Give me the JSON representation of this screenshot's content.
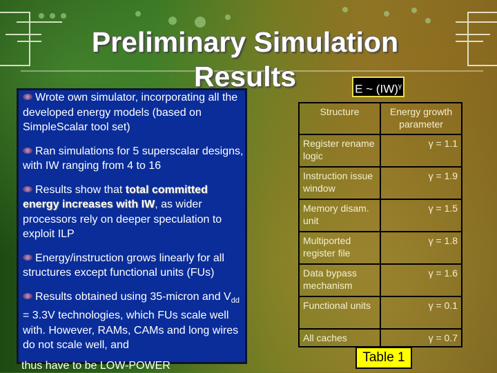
{
  "slide": {
    "title_line1": "Preliminary Simulation",
    "title_line2": "Results",
    "formula": {
      "base": "E ~ (IW)",
      "exponent": "γ"
    }
  },
  "bullets": [
    {
      "icon": "bullet-icon",
      "text": "Wrote own simulator, incorporating all the developed energy models (based on SimpleScalar tool set)"
    },
    {
      "icon": "bullet-icon",
      "text": "Ran simulations for 5 superscalar designs, with IW ranging from 4 to 16"
    },
    {
      "icon": "bullet-icon",
      "prefix": "Results show that ",
      "bold": "total committed energy increases with IW",
      "suffix": ", as wider processors rely on deeper speculation to exploit ILP"
    },
    {
      "icon": "bullet-icon",
      "text": "Energy/instruction grows linearly for all structures except functional units (FUs)"
    },
    {
      "icon": "bullet-icon",
      "prefix": "Results obtained using 35-micron and V",
      "subscript": "dd",
      "suffix": " = 3.3V technologies, which FUs scale well with.  However, RAMs, CAMs and long wires do not scale well, and",
      "overflow": "thus have to be LOW-POWER"
    }
  ],
  "table": {
    "headers": [
      "Structure",
      "Energy growth parameter"
    ],
    "rows": [
      {
        "structure": "Register rename logic",
        "value": "γ = 1.1"
      },
      {
        "structure": "Instruction issue window",
        "value": "γ = 1.9"
      },
      {
        "structure": "Memory disam. unit",
        "value": "γ = 1.5"
      },
      {
        "structure": "Multiported register file",
        "value": "γ = 1.8"
      },
      {
        "structure": "Data bypass mechanism",
        "value": "γ = 1.6"
      },
      {
        "structure": "Functional units",
        "value": "γ = 0.1"
      },
      {
        "structure": "All caches",
        "value": "γ = 0.7"
      }
    ],
    "caption": "Table 1"
  },
  "colors": {
    "bullet_panel": "#0a2d9a",
    "formula_border": "#e8e050",
    "caption_bg": "#ffff00"
  }
}
